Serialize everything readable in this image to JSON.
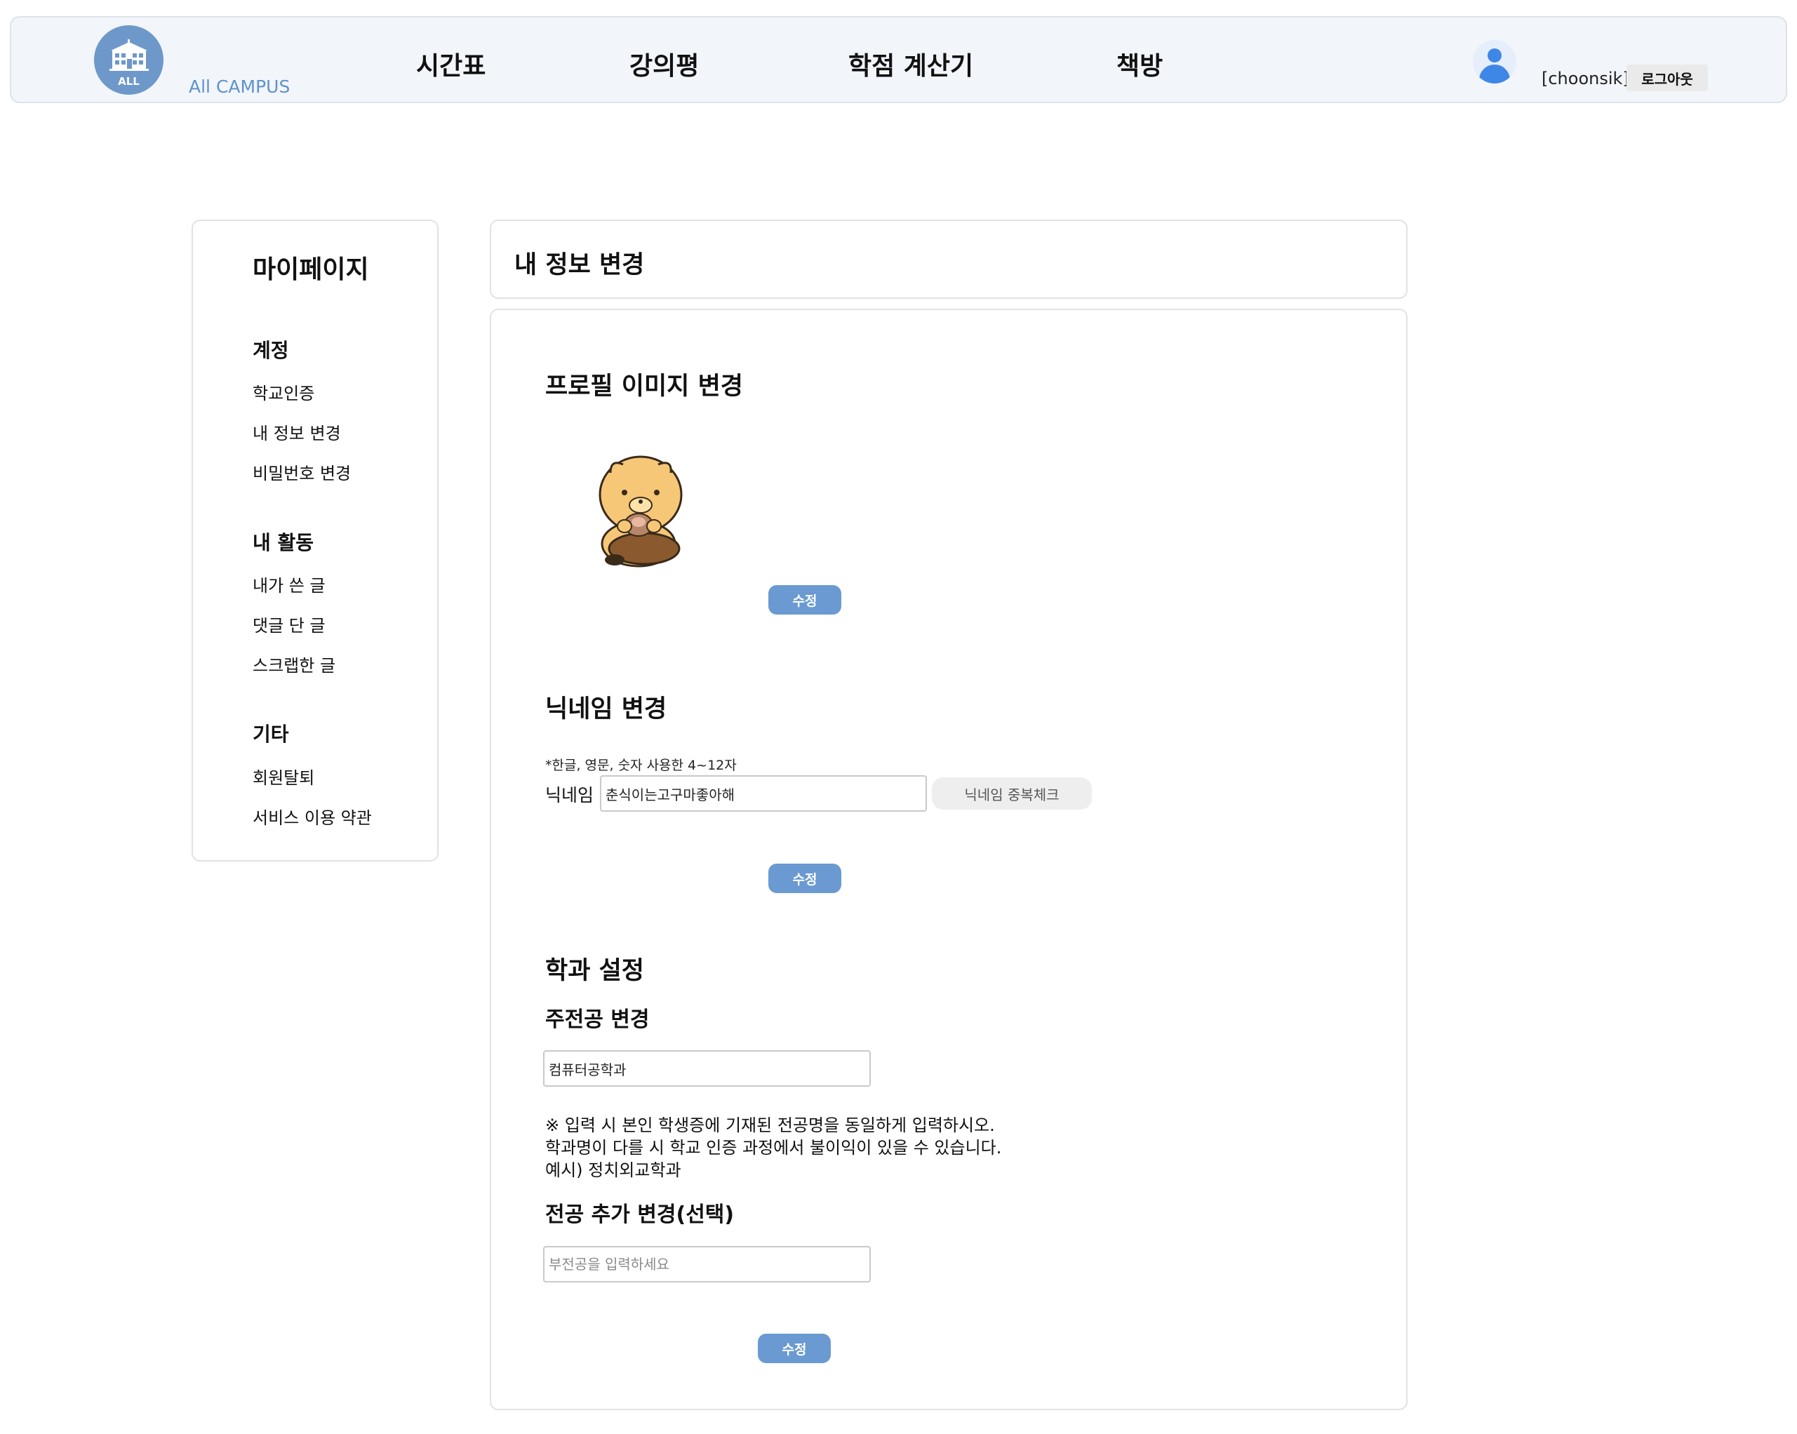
{
  "header": {
    "logo_abbr": "ALL",
    "logo_text": "All CAMPUS",
    "nav": [
      "시간표",
      "강의평",
      "학점 계산기",
      "책방"
    ],
    "username": "[choonsik]",
    "logout_label": "로그아웃"
  },
  "sidebar": {
    "title": "마이페이지",
    "sections": [
      {
        "title": "계정",
        "links": [
          "학교인증",
          "내 정보 변경",
          "비밀번호 변경"
        ]
      },
      {
        "title": "내 활동",
        "links": [
          "내가 쓴 글",
          "댓글 단 글",
          "스크랩한 글"
        ]
      },
      {
        "title": "기타",
        "links": [
          "회원탈퇴",
          "서비스 이용 약관"
        ]
      }
    ]
  },
  "main": {
    "title": "내 정보 변경",
    "profile": {
      "title": "프로필 이미지 변경",
      "edit_label": "수정"
    },
    "nickname": {
      "title": "닉네임 변경",
      "hint": "*한글, 영문, 숫자 사용한 4~12자",
      "label": "닉네임",
      "value": "춘식이는고구마좋아해",
      "dup_check_label": "닉네임 중복체크",
      "edit_label": "수정"
    },
    "department": {
      "title": "학과 설정",
      "major_title": "주전공 변경",
      "major_value": "컴퓨터공학과",
      "notice": [
        "※ 입력 시 본인 학생증에 기재된 전공명을 동일하게 입력하시오.",
        "학과명이 다를 시 학교 인증 과정에서 불이익이 있을 수 있습니다.",
        "예시) 정치외교학과"
      ],
      "extra_title": "전공 추가 변경(선택)",
      "extra_placeholder": "부전공을 입력하세요",
      "edit_label": "수정"
    }
  },
  "colors": {
    "accent": "#6a9ad1",
    "logo_blue": "#6e98c9",
    "header_bg": "#f2f5fa"
  }
}
